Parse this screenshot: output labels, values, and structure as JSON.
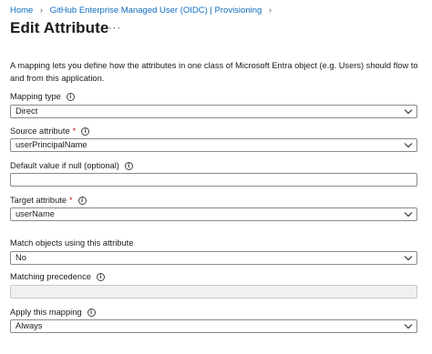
{
  "breadcrumb": {
    "home": "Home",
    "app": "GitHub Enterprise Managed User (OIDC) | Provisioning"
  },
  "page": {
    "title": "Edit Attribute",
    "more": "···"
  },
  "description": "A mapping lets you define how the attributes in one class of Microsoft Entra object (e.g. Users) should flow to and from this application.",
  "fields": {
    "mapping_type": {
      "label": "Mapping type",
      "value": "Direct"
    },
    "source_attribute": {
      "label": "Source attribute",
      "required": "*",
      "value": "userPrincipalName"
    },
    "default_value": {
      "label": "Default value if null (optional)",
      "value": ""
    },
    "target_attribute": {
      "label": "Target attribute",
      "required": "*",
      "value": "userName"
    },
    "match_objects": {
      "label": "Match objects using this attribute",
      "value": "No"
    },
    "matching_precedence": {
      "label": "Matching precedence",
      "value": ""
    },
    "apply_mapping": {
      "label": "Apply this mapping",
      "value": "Always"
    }
  },
  "icons": {
    "info": "info-icon",
    "chevron": "chevron-down-icon",
    "breadcrumb_separator": "chevron-right-icon"
  }
}
